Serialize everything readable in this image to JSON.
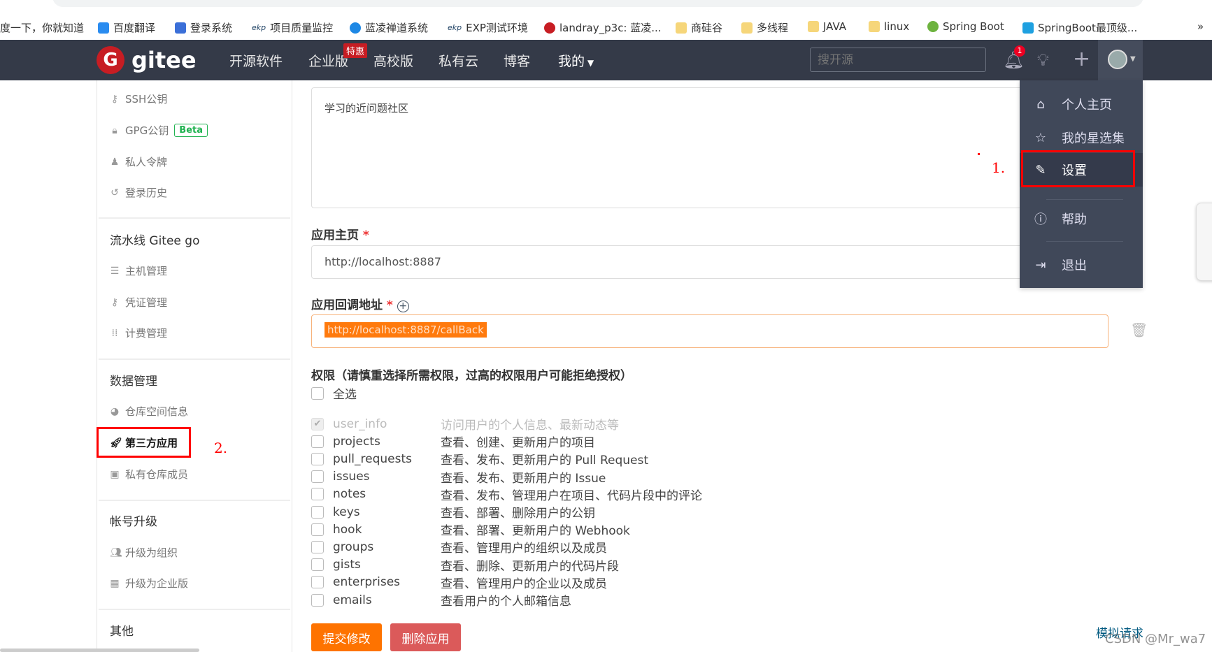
{
  "browser": {
    "bookmarks": [
      "度一下，你就知道",
      "百度翻译",
      "登录系统",
      "项目质量监控",
      "蓝凌禅道系统",
      "EXP测试环境",
      "landray_p3c: 蓝凌...",
      "商硅谷",
      "多线程",
      "JAVA",
      "linux",
      "Spring Boot",
      "SpringBoot最顶级..."
    ],
    "more": "»"
  },
  "nav": {
    "logo": "gitee",
    "logo_mark": "G",
    "items": [
      "开源软件",
      "企业版",
      "高校版",
      "私有云",
      "博客",
      "我的"
    ],
    "badge": "特惠",
    "search_placeholder": "搜开源",
    "notifications": "1"
  },
  "dropdown": {
    "items": [
      {
        "label": "个人主页",
        "icon": "home-icon"
      },
      {
        "label": "我的星选集",
        "icon": "star-icon"
      },
      {
        "label": "设置",
        "icon": "edit-icon"
      },
      {
        "label": "帮助",
        "icon": "help-icon"
      },
      {
        "label": "退出",
        "icon": "logout-icon"
      }
    ]
  },
  "sidebar": {
    "items_top": [
      "SSH公钥",
      "GPG公钥",
      "私人令牌",
      "登录历史"
    ],
    "beta": "Beta",
    "pipeline": {
      "title": "流水线 Gitee go",
      "items": [
        "主机管理",
        "凭证管理",
        "计费管理"
      ]
    },
    "data": {
      "title": "数据管理",
      "items": [
        "仓库空间信息",
        "第三方应用",
        "私有仓库成员"
      ]
    },
    "upgrade": {
      "title": "帐号升级",
      "items": [
        "升级为组织",
        "升级为企业版"
      ]
    },
    "other": {
      "title": "其他"
    }
  },
  "annotations": {
    "one": "1.",
    "two": "2."
  },
  "form": {
    "description": "学习的近问题社区",
    "homepage_label": "应用主页",
    "required": "*",
    "homepage_value": "http://localhost:8887",
    "callback_label": "应用回调地址",
    "callback_value": "http://localhost:8887/callBack",
    "perm_title": "权限（请慎重选择所需权限，过高的权限用户可能拒绝授权）",
    "select_all": "全选",
    "permissions": [
      {
        "name": "user_info",
        "desc": "访问用户的个人信息、最新动态等",
        "checked": true,
        "disabled": true
      },
      {
        "name": "projects",
        "desc": "查看、创建、更新用户的项目"
      },
      {
        "name": "pull_requests",
        "desc": "查看、发布、更新用户的 Pull Request"
      },
      {
        "name": "issues",
        "desc": "查看、发布、更新用户的 Issue"
      },
      {
        "name": "notes",
        "desc": "查看、发布、管理用户在项目、代码片段中的评论"
      },
      {
        "name": "keys",
        "desc": "查看、部署、删除用户的公钥"
      },
      {
        "name": "hook",
        "desc": "查看、部署、更新用户的 Webhook"
      },
      {
        "name": "groups",
        "desc": "查看、管理用户的组织以及成员"
      },
      {
        "name": "gists",
        "desc": "查看、删除、更新用户的代码片段"
      },
      {
        "name": "enterprises",
        "desc": "查看、管理用户的企业以及成员"
      },
      {
        "name": "emails",
        "desc": "查看用户的个人邮箱信息"
      }
    ],
    "submit": "提交修改",
    "delete": "删除应用",
    "simulate": "模拟请求"
  },
  "watermark": "CSDN @Mr_wa7",
  "colors": {
    "nav_bg": "#343a48",
    "brand": "#c71d23",
    "submit": "#fe7300",
    "delete": "#db5a5a",
    "link": "#005980"
  }
}
